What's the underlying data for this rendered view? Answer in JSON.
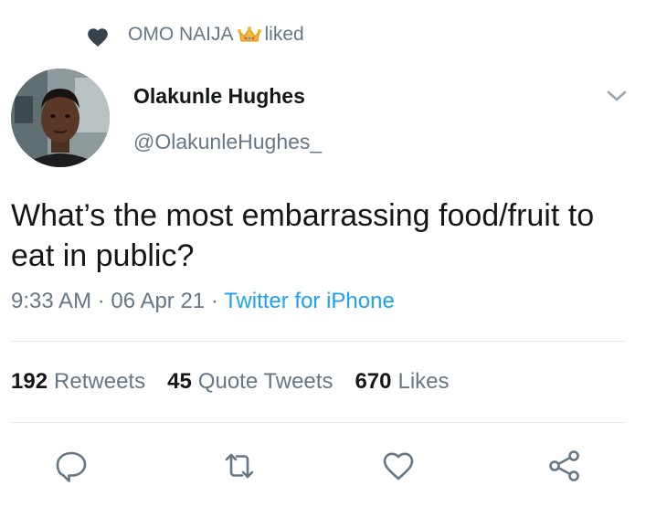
{
  "social_context": {
    "user": "OMO NAIJA",
    "action": "liked"
  },
  "author": {
    "name": "Olakunle Hughes",
    "handle": "@OlakunleHughes_"
  },
  "tweet": {
    "text": "What’s the most embarrassing food/fruit to eat in public?",
    "time": "9:33 AM",
    "date": "06 Apr 21",
    "source": "Twitter for iPhone",
    "separator": "·"
  },
  "stats": {
    "retweets_count": "192",
    "retweets_label": "Retweets",
    "quotes_count": "45",
    "quotes_label": "Quote Tweets",
    "likes_count": "670",
    "likes_label": "Likes"
  },
  "actions": [
    {
      "icon": "reply-icon"
    },
    {
      "icon": "retweet-icon"
    },
    {
      "icon": "like-icon"
    },
    {
      "icon": "share-icon"
    }
  ],
  "colors": {
    "secondary_text": "#657786",
    "link": "#1da1f2",
    "primary_text": "#14171a",
    "divider": "#e1e8ed"
  }
}
